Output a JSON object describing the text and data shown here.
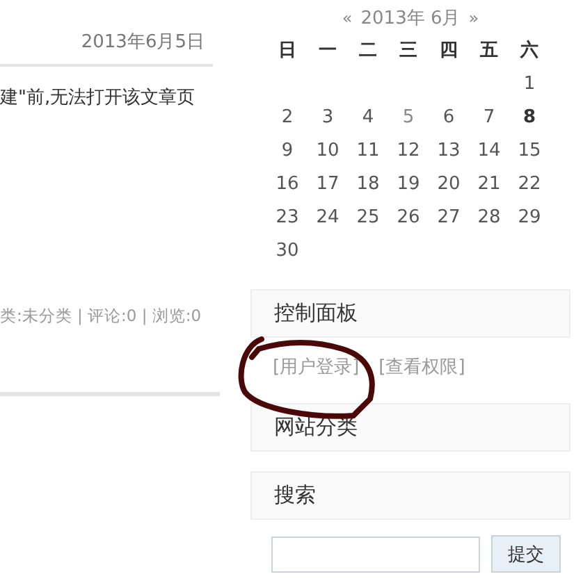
{
  "post": {
    "date": "2013年6月5日",
    "excerpt": "建\"前,无法打开该文章页",
    "meta": "类:未分类 | 评论:0 | 浏览:0"
  },
  "calendar": {
    "prev": "«",
    "caption": "2013年 6月",
    "next": "»",
    "weekdays": [
      "日",
      "一",
      "二",
      "三",
      "四",
      "五",
      "六"
    ],
    "weeks": [
      [
        {
          "day": "1",
          "kind": "plain"
        }
      ],
      [
        {
          "day": "2",
          "kind": "plain"
        },
        {
          "day": "3",
          "kind": "plain"
        },
        {
          "day": "4",
          "kind": "plain"
        },
        {
          "day": "5",
          "kind": "post"
        },
        {
          "day": "6",
          "kind": "plain"
        },
        {
          "day": "7",
          "kind": "plain"
        },
        {
          "day": "8",
          "kind": "today"
        }
      ],
      [
        {
          "day": "9",
          "kind": "plain"
        },
        {
          "day": "10",
          "kind": "plain"
        },
        {
          "day": "11",
          "kind": "plain"
        },
        {
          "day": "12",
          "kind": "plain"
        },
        {
          "day": "13",
          "kind": "plain"
        },
        {
          "day": "14",
          "kind": "plain"
        },
        {
          "day": "15",
          "kind": "plain"
        }
      ],
      [
        {
          "day": "16",
          "kind": "plain"
        },
        {
          "day": "17",
          "kind": "plain"
        },
        {
          "day": "18",
          "kind": "plain"
        },
        {
          "day": "19",
          "kind": "plain"
        },
        {
          "day": "20",
          "kind": "plain"
        },
        {
          "day": "21",
          "kind": "plain"
        },
        {
          "day": "22",
          "kind": "plain"
        }
      ],
      [
        {
          "day": "23",
          "kind": "plain"
        },
        {
          "day": "24",
          "kind": "plain"
        },
        {
          "day": "25",
          "kind": "plain"
        },
        {
          "day": "26",
          "kind": "plain"
        },
        {
          "day": "27",
          "kind": "plain"
        },
        {
          "day": "28",
          "kind": "plain"
        },
        {
          "day": "29",
          "kind": "plain"
        }
      ],
      [
        {
          "day": "30",
          "kind": "plain"
        }
      ]
    ]
  },
  "panels": [
    {
      "title": "控制面板",
      "links": [
        "[用户登录]",
        "[查看权限]"
      ]
    },
    {
      "title": "网站分类"
    },
    {
      "title": "搜索",
      "search": {
        "button": "提交"
      }
    }
  ],
  "annotation": {
    "kind": "circle"
  }
}
